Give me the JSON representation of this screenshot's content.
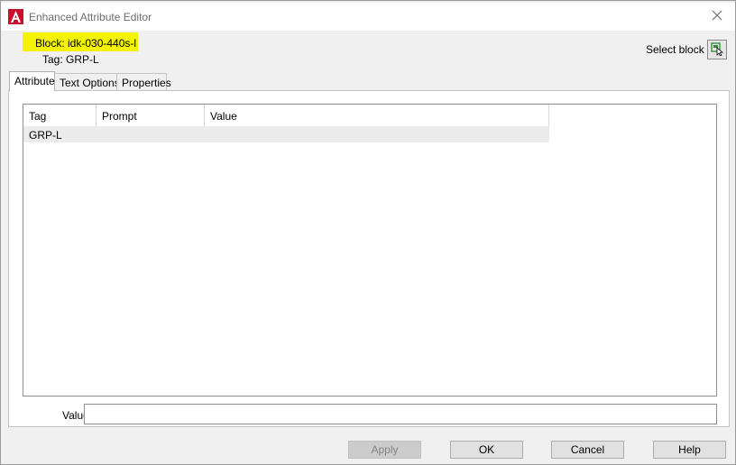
{
  "window": {
    "title": "Enhanced Attribute Editor"
  },
  "header": {
    "block_label": "Block: idk-030-440s-l",
    "tag_label": "Tag: GRP-L",
    "select_block_label": "Select block",
    "highlight_color": "#f4f400"
  },
  "tabs": [
    {
      "label": "Attribute",
      "active": true
    },
    {
      "label": "Text Options",
      "active": false
    },
    {
      "label": "Properties",
      "active": false
    }
  ],
  "grid": {
    "columns": [
      "Tag",
      "Prompt",
      "Value"
    ],
    "rows": [
      {
        "tag": "GRP-L",
        "prompt": "",
        "value": ""
      }
    ]
  },
  "value_field": {
    "label": "Value:",
    "value": ""
  },
  "buttons": {
    "apply": "Apply",
    "ok": "OK",
    "cancel": "Cancel",
    "help": "Help"
  },
  "icons": {
    "app": "autocad-logo-icon",
    "close": "close-icon",
    "select_block": "select-object-icon"
  },
  "colors": {
    "app_icon_red": "#c8102e",
    "select_icon_green": "#2e8b3a"
  }
}
